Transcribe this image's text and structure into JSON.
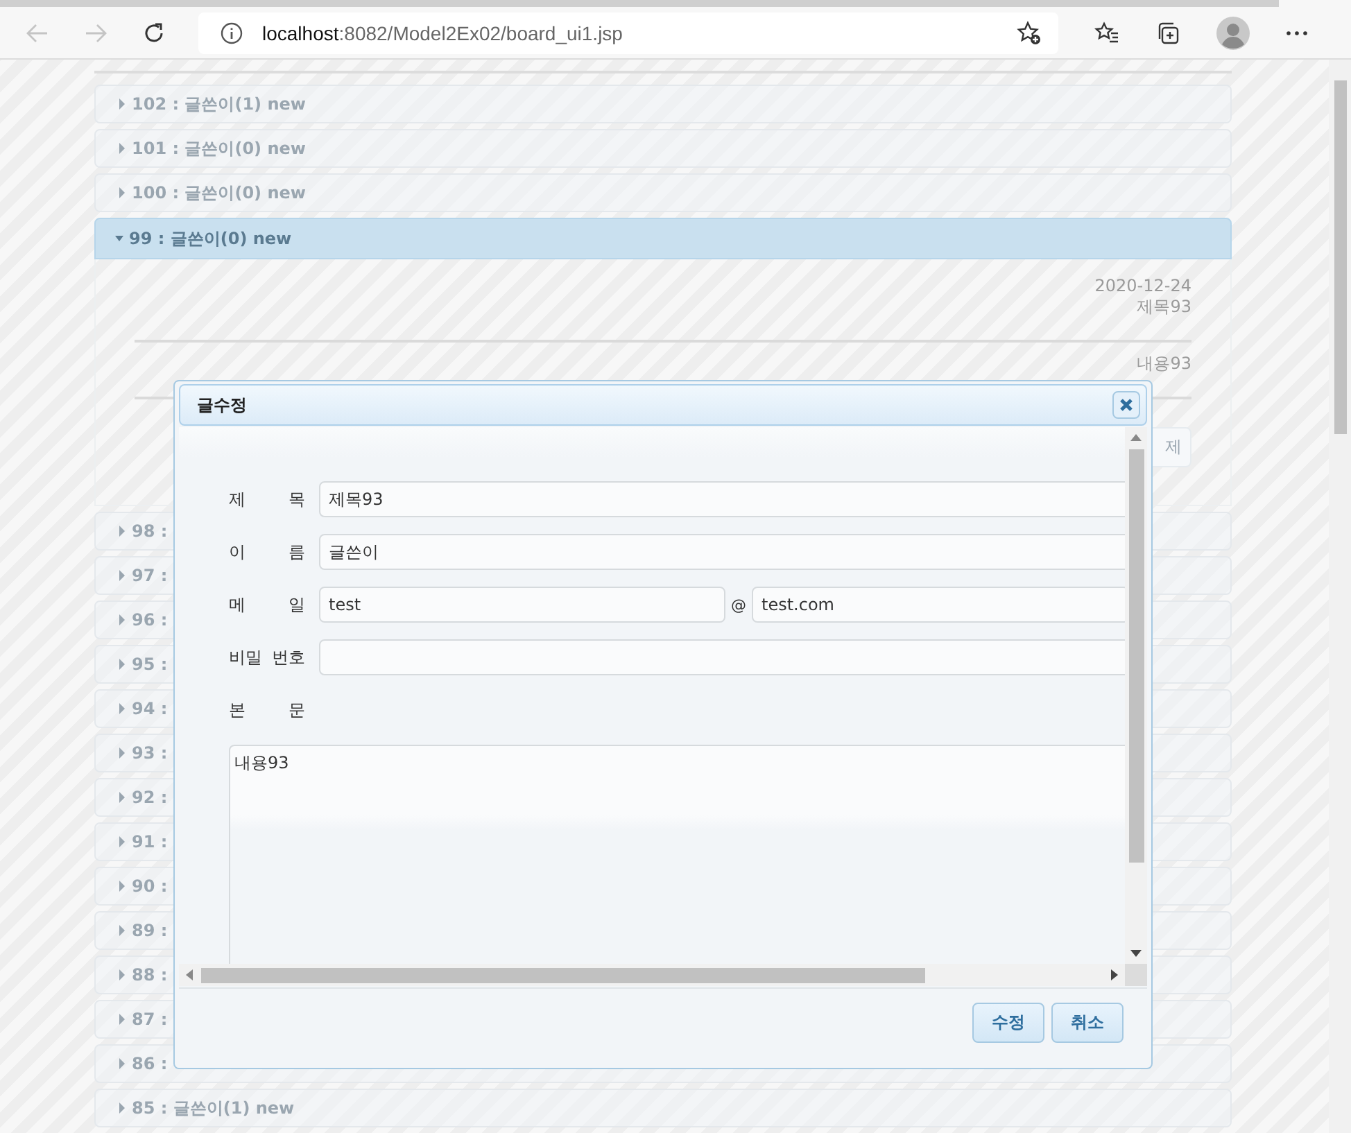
{
  "browser": {
    "back_disabled": true,
    "forward_disabled": true,
    "url_host": "localhost",
    "url_path": ":8082/Model2Ex02/board_ui1.jsp"
  },
  "board": {
    "posts": [
      {
        "title": "102 : 글쓴이(1) new",
        "expanded": false
      },
      {
        "title": "101 : 글쓴이(0) new",
        "expanded": false
      },
      {
        "title": "100 : 글쓴이(0) new",
        "expanded": false
      },
      {
        "title": "99 : 글쓴이(0) new",
        "expanded": true,
        "date": "2020-12-24",
        "subject": "제목93",
        "content": "내용93",
        "delete_button": "제"
      },
      {
        "title": "98 :",
        "expanded": false
      },
      {
        "title": "97 :",
        "expanded": false
      },
      {
        "title": "96 :",
        "expanded": false
      },
      {
        "title": "95 :",
        "expanded": false
      },
      {
        "title": "94 :",
        "expanded": false
      },
      {
        "title": "93 :",
        "expanded": false
      },
      {
        "title": "92 :",
        "expanded": false
      },
      {
        "title": "91 :",
        "expanded": false
      },
      {
        "title": "90 :",
        "expanded": false
      },
      {
        "title": "89 :",
        "expanded": false
      },
      {
        "title": "88 :",
        "expanded": false
      },
      {
        "title": "87 :",
        "expanded": false
      },
      {
        "title": "86 :",
        "expanded": false
      },
      {
        "title": "85 : 글쓴이(1) new",
        "expanded": false
      }
    ]
  },
  "dialog": {
    "title": "글수정",
    "fields": [
      {
        "kind": "text",
        "label": "제 목",
        "value": "제목93"
      },
      {
        "kind": "text",
        "label": "이 름",
        "value": "글쓴이"
      },
      {
        "kind": "email",
        "label": "메 일",
        "value": "test",
        "at": "@",
        "domain": "test.com"
      },
      {
        "kind": "password",
        "label": "비밀 번호"
      },
      {
        "kind": "textarea",
        "label": "본 문",
        "value": "내용93"
      }
    ],
    "buttons": [
      {
        "label": "수정"
      },
      {
        "label": "취소"
      }
    ]
  }
}
